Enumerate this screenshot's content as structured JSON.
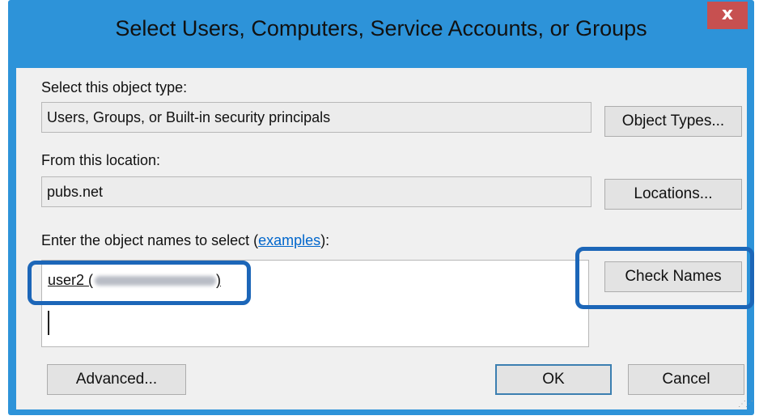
{
  "dialog": {
    "title": "Select Users, Computers, Service Accounts, or Groups",
    "close_label": "x"
  },
  "object_type": {
    "label": "Select this object type:",
    "value": "Users, Groups, or Built-in security principals",
    "button": "Object Types..."
  },
  "location": {
    "label": "From this location:",
    "value": "pubs.net",
    "button": "Locations..."
  },
  "object_names": {
    "label_prefix": "Enter the object names to select (",
    "link": "examples",
    "label_suffix": "):",
    "entry": "user2 (",
    "entry_close": ")",
    "check_button": "Check Names"
  },
  "footer": {
    "advanced_button": "Advanced...",
    "ok_button": "OK",
    "cancel_button": "Cancel"
  },
  "colors": {
    "frame": "#2d93d9",
    "close": "#c75050",
    "highlight": "#1c66b8",
    "link": "#0066cc"
  }
}
